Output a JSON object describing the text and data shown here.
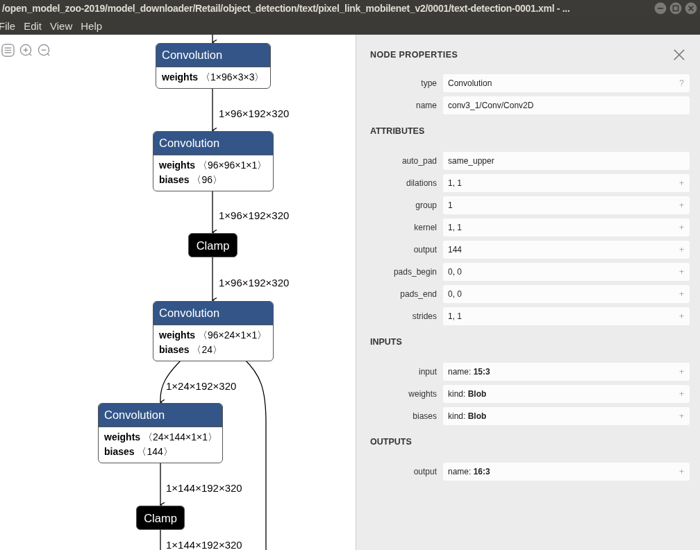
{
  "window": {
    "title": "/open_model_zoo-2019/model_downloader/Retail/object_detection/text/pixel_link_mobilenet_v2/0001/text-detection-0001.xml - ..."
  },
  "menu": [
    "File",
    "Edit",
    "View",
    "Help"
  ],
  "graph": {
    "nodes": [
      {
        "kind": "layer",
        "title": "Convolution",
        "attrs": [
          {
            "name": "weights",
            "value": "〈1×96×3×3〉"
          }
        ]
      },
      {
        "kind": "layer",
        "title": "Convolution",
        "attrs": [
          {
            "name": "weights",
            "value": "〈96×96×1×1〉"
          },
          {
            "name": "biases",
            "value": "〈96〉"
          }
        ]
      },
      {
        "kind": "activation",
        "title": "Clamp"
      },
      {
        "kind": "layer",
        "title": "Convolution",
        "attrs": [
          {
            "name": "weights",
            "value": "〈96×24×1×1〉"
          },
          {
            "name": "biases",
            "value": "〈24〉"
          }
        ]
      },
      {
        "kind": "layer",
        "title": "Convolution",
        "attrs": [
          {
            "name": "weights",
            "value": "〈24×144×1×1〉"
          },
          {
            "name": "biases",
            "value": "〈144〉"
          }
        ]
      },
      {
        "kind": "activation",
        "title": "Clamp"
      }
    ],
    "edges": [
      {
        "label": "1×96×192×320"
      },
      {
        "label": "1×96×192×320"
      },
      {
        "label": "1×96×192×320"
      },
      {
        "label": "1×24×192×320"
      },
      {
        "label": "1×144×192×320"
      },
      {
        "label": "1×144×192×320"
      }
    ]
  },
  "properties": {
    "title": "NODE PROPERTIES",
    "sections": [
      {
        "rows": [
          {
            "label": "type",
            "value": "Convolution",
            "action": "?"
          },
          {
            "label": "name",
            "value": "conv3_1/Conv/Conv2D"
          }
        ]
      },
      {
        "heading": "ATTRIBUTES",
        "rows": [
          {
            "label": "auto_pad",
            "value": "same_upper"
          },
          {
            "label": "dilations",
            "value": "1, 1",
            "action": "+"
          },
          {
            "label": "group",
            "value": "1",
            "action": "+"
          },
          {
            "label": "kernel",
            "value": "1, 1",
            "action": "+"
          },
          {
            "label": "output",
            "value": "144",
            "action": "+"
          },
          {
            "label": "pads_begin",
            "value": "0, 0",
            "action": "+"
          },
          {
            "label": "pads_end",
            "value": "0, 0",
            "action": "+"
          },
          {
            "label": "strides",
            "value": "1, 1",
            "action": "+"
          }
        ]
      },
      {
        "heading": "INPUTS",
        "rows": [
          {
            "label": "input",
            "value": "name: **15:3**",
            "action": "+"
          },
          {
            "label": "weights",
            "value": "kind: **Blob**",
            "action": "+"
          },
          {
            "label": "biases",
            "value": "kind: **Blob**",
            "action": "+"
          }
        ]
      },
      {
        "heading": "OUTPUTS",
        "rows": [
          {
            "label": "output",
            "value": "name: **16:3**",
            "action": "+"
          }
        ]
      }
    ]
  }
}
